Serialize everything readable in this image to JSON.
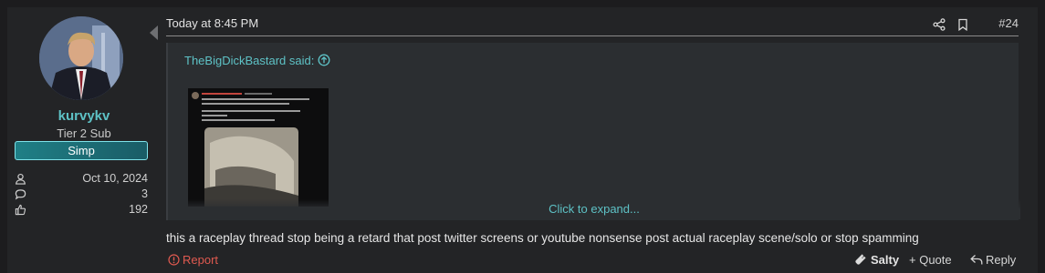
{
  "user": {
    "username": "kurvykv",
    "title": "Tier 2 Sub",
    "banner": "Simp",
    "stats": [
      {
        "icon": "user-icon",
        "value": "Oct 10, 2024"
      },
      {
        "icon": "comment-icon",
        "value": "3"
      },
      {
        "icon": "thumbs-up-icon",
        "value": "192"
      }
    ]
  },
  "post": {
    "time": "Today at 8:45 PM",
    "number": "#24",
    "quote": {
      "author_said": "TheBigDickBastard said:",
      "expand_label": "Click to expand..."
    },
    "body": "this a raceplay thread stop being a retard that post twitter screens or youtube nonsense post actual raceplay scene/solo or stop spamming"
  },
  "footer": {
    "report": "Report",
    "reaction": "Salty",
    "quote": "+ Quote",
    "reply": "Reply"
  },
  "colors": {
    "accent": "#5ec2c6",
    "report": "#e05a50",
    "banner": "#1f7f86"
  }
}
